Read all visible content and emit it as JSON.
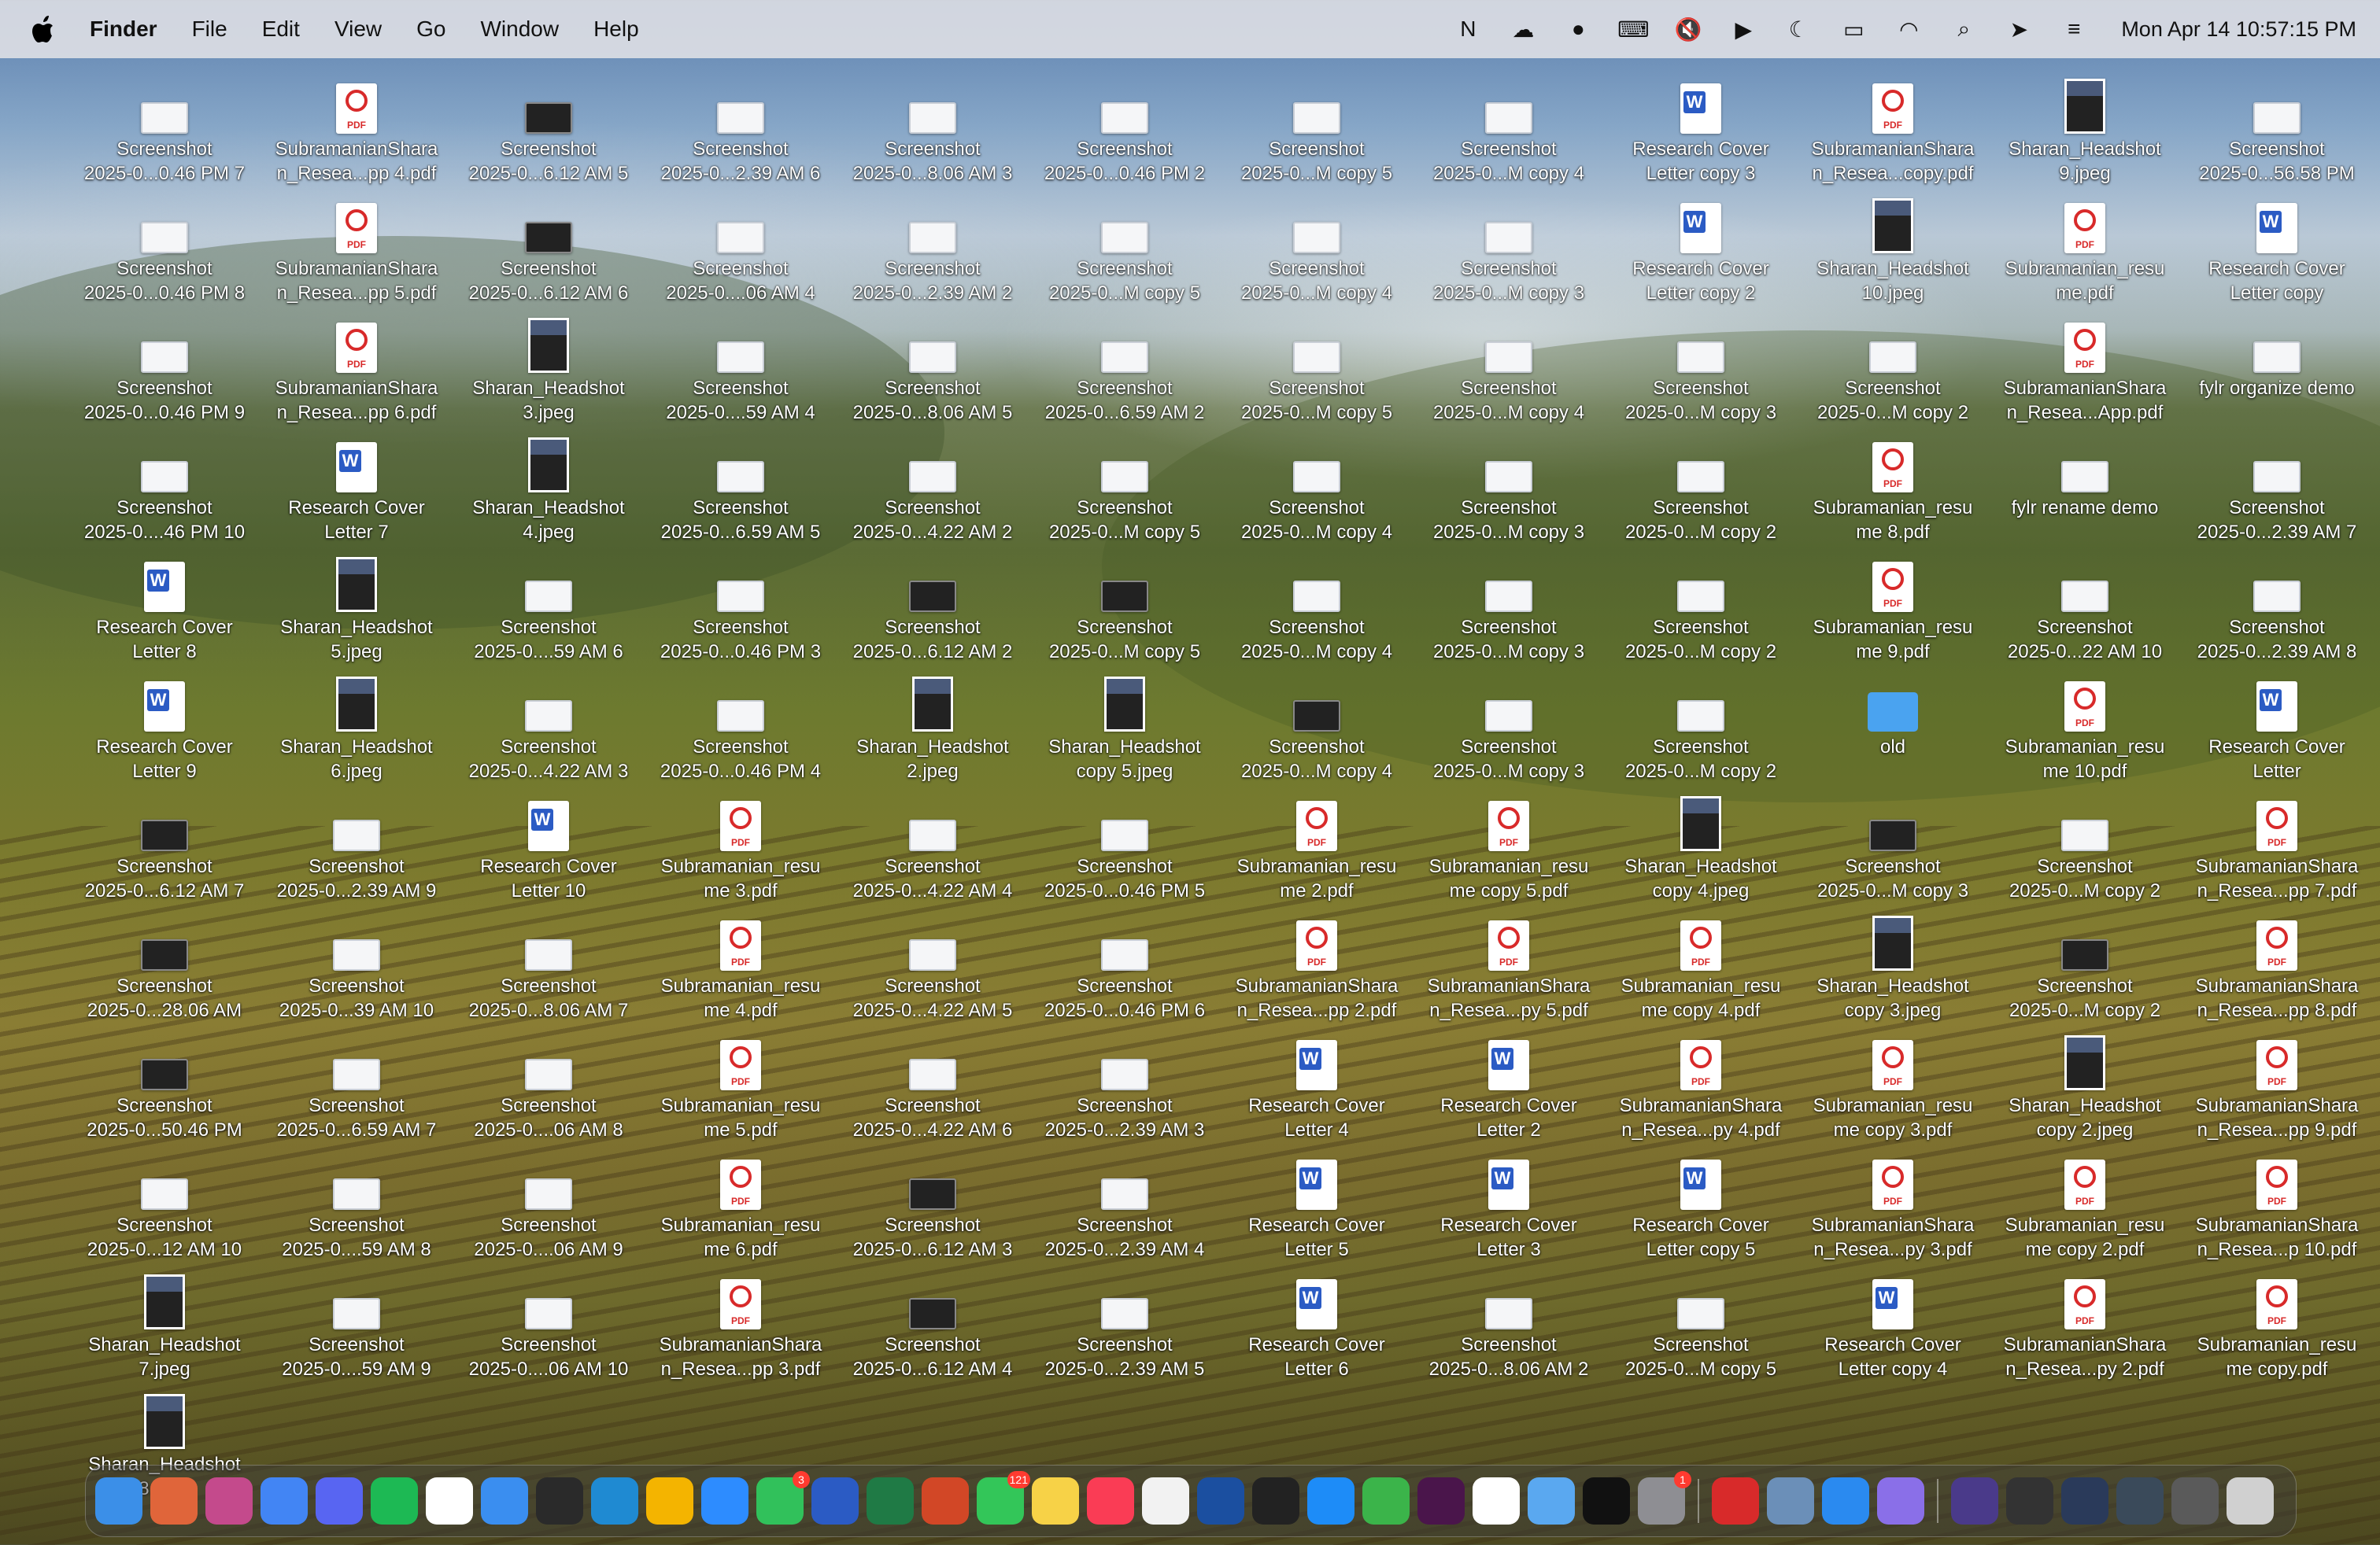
{
  "menubar": {
    "app_name": "Finder",
    "menus": [
      "File",
      "Edit",
      "View",
      "Go",
      "Window",
      "Help"
    ],
    "status_icons": [
      "notion-icon",
      "creative-cloud-icon",
      "stop-icon",
      "keyboard-icon",
      "mute-icon",
      "play-icon",
      "moon-icon",
      "battery-icon",
      "wifi-icon",
      "search-icon",
      "location-icon",
      "control-center-icon"
    ],
    "clock": "Mon Apr 14  10:57:15 PM"
  },
  "desktop_icons": [
    {
      "kind": "shot",
      "name": "Screenshot 2025-0...0.46 PM 7"
    },
    {
      "kind": "pdf",
      "name": "SubramanianShara n_Resea...pp 4.pdf"
    },
    {
      "kind": "shotd",
      "name": "Screenshot 2025-0...6.12 AM 5"
    },
    {
      "kind": "shot",
      "name": "Screenshot 2025-0...2.39 AM 6"
    },
    {
      "kind": "shot",
      "name": "Screenshot 2025-0...8.06 AM 3"
    },
    {
      "kind": "shot",
      "name": "Screenshot 2025-0...0.46 PM 2"
    },
    {
      "kind": "shot",
      "name": "Screenshot 2025-0...M copy 5"
    },
    {
      "kind": "shot",
      "name": "Screenshot 2025-0...M copy 4"
    },
    {
      "kind": "doc",
      "name": "Research Cover Letter copy 3"
    },
    {
      "kind": "pdf",
      "name": "SubramanianShara n_Resea...copy.pdf"
    },
    {
      "kind": "jpg",
      "name": "Sharan_Headshot 9.jpeg"
    },
    {
      "kind": "shot",
      "name": "Screenshot 2025-0...56.58 PM"
    },
    {
      "kind": "shot",
      "name": "Screenshot 2025-0...0.46 PM 8"
    },
    {
      "kind": "pdf",
      "name": "SubramanianShara n_Resea...pp 5.pdf"
    },
    {
      "kind": "shotd",
      "name": "Screenshot 2025-0...6.12 AM 6"
    },
    {
      "kind": "shot",
      "name": "Screenshot 2025-0....06 AM 4"
    },
    {
      "kind": "shot",
      "name": "Screenshot 2025-0...2.39 AM 2"
    },
    {
      "kind": "shot",
      "name": "Screenshot 2025-0...M copy 5"
    },
    {
      "kind": "shot",
      "name": "Screenshot 2025-0...M copy 4"
    },
    {
      "kind": "shot",
      "name": "Screenshot 2025-0...M copy 3"
    },
    {
      "kind": "doc",
      "name": "Research Cover Letter copy 2"
    },
    {
      "kind": "jpg",
      "name": "Sharan_Headshot 10.jpeg"
    },
    {
      "kind": "pdf",
      "name": "Subramanian_resu me.pdf"
    },
    {
      "kind": "doc",
      "name": "Research Cover Letter copy"
    },
    {
      "kind": "shot",
      "name": "Screenshot 2025-0...0.46 PM 9"
    },
    {
      "kind": "pdf",
      "name": "SubramanianShara n_Resea...pp 6.pdf"
    },
    {
      "kind": "jpg",
      "name": "Sharan_Headshot 3.jpeg"
    },
    {
      "kind": "shot",
      "name": "Screenshot 2025-0....59 AM 4"
    },
    {
      "kind": "shot",
      "name": "Screenshot 2025-0...8.06 AM 5"
    },
    {
      "kind": "shot",
      "name": "Screenshot 2025-0...6.59 AM 2"
    },
    {
      "kind": "shot",
      "name": "Screenshot 2025-0...M copy 5"
    },
    {
      "kind": "shot",
      "name": "Screenshot 2025-0...M copy 4"
    },
    {
      "kind": "shot",
      "name": "Screenshot 2025-0...M copy 3"
    },
    {
      "kind": "shot",
      "name": "Screenshot 2025-0...M copy 2"
    },
    {
      "kind": "pdf",
      "name": "SubramanianShara n_Resea...App.pdf"
    },
    {
      "kind": "shot",
      "name": "fylr organize demo"
    },
    {
      "kind": "shot",
      "name": "Screenshot 2025-0....46 PM 10"
    },
    {
      "kind": "doc",
      "name": "Research Cover Letter 7"
    },
    {
      "kind": "jpg",
      "name": "Sharan_Headshot 4.jpeg"
    },
    {
      "kind": "shot",
      "name": "Screenshot 2025-0...6.59 AM 5"
    },
    {
      "kind": "shot",
      "name": "Screenshot 2025-0...4.22 AM 2"
    },
    {
      "kind": "shot",
      "name": "Screenshot 2025-0...M copy 5"
    },
    {
      "kind": "shot",
      "name": "Screenshot 2025-0...M copy 4"
    },
    {
      "kind": "shot",
      "name": "Screenshot 2025-0...M copy 3"
    },
    {
      "kind": "shot",
      "name": "Screenshot 2025-0...M copy 2"
    },
    {
      "kind": "pdf",
      "name": "Subramanian_resu me 8.pdf"
    },
    {
      "kind": "shot",
      "name": "fylr rename demo"
    },
    {
      "kind": "shot",
      "name": "Screenshot 2025-0...2.39 AM 7"
    },
    {
      "kind": "doc",
      "name": "Research Cover Letter 8"
    },
    {
      "kind": "jpg",
      "name": "Sharan_Headshot 5.jpeg"
    },
    {
      "kind": "shot",
      "name": "Screenshot 2025-0....59 AM 6"
    },
    {
      "kind": "shot",
      "name": "Screenshot 2025-0...0.46 PM 3"
    },
    {
      "kind": "shotd",
      "name": "Screenshot 2025-0...6.12 AM 2"
    },
    {
      "kind": "shotd",
      "name": "Screenshot 2025-0...M copy 5"
    },
    {
      "kind": "shot",
      "name": "Screenshot 2025-0...M copy 4"
    },
    {
      "kind": "shot",
      "name": "Screenshot 2025-0...M copy 3"
    },
    {
      "kind": "shot",
      "name": "Screenshot 2025-0...M copy 2"
    },
    {
      "kind": "pdf",
      "name": "Subramanian_resu me 9.pdf"
    },
    {
      "kind": "shot",
      "name": "Screenshot 2025-0...22 AM 10"
    },
    {
      "kind": "shot",
      "name": "Screenshot 2025-0...2.39 AM 8"
    },
    {
      "kind": "doc",
      "name": "Research Cover Letter 9"
    },
    {
      "kind": "jpg",
      "name": "Sharan_Headshot 6.jpeg"
    },
    {
      "kind": "shot",
      "name": "Screenshot 2025-0...4.22 AM 3"
    },
    {
      "kind": "shot",
      "name": "Screenshot 2025-0...0.46 PM 4"
    },
    {
      "kind": "jpg",
      "name": "Sharan_Headshot 2.jpeg"
    },
    {
      "kind": "jpg",
      "name": "Sharan_Headshot copy 5.jpeg"
    },
    {
      "kind": "shotd",
      "name": "Screenshot 2025-0...M copy 4"
    },
    {
      "kind": "shot",
      "name": "Screenshot 2025-0...M copy 3"
    },
    {
      "kind": "shot",
      "name": "Screenshot 2025-0...M copy 2"
    },
    {
      "kind": "folder",
      "name": "old"
    },
    {
      "kind": "pdf",
      "name": "Subramanian_resu me 10.pdf"
    },
    {
      "kind": "doc",
      "name": "Research Cover Letter"
    },
    {
      "kind": "shotd",
      "name": "Screenshot 2025-0...6.12 AM 7"
    },
    {
      "kind": "shot",
      "name": "Screenshot 2025-0...2.39 AM 9"
    },
    {
      "kind": "doc",
      "name": "Research Cover Letter 10"
    },
    {
      "kind": "pdf",
      "name": "Subramanian_resu me 3.pdf"
    },
    {
      "kind": "shot",
      "name": "Screenshot 2025-0...4.22 AM 4"
    },
    {
      "kind": "shot",
      "name": "Screenshot 2025-0...0.46 PM 5"
    },
    {
      "kind": "pdf",
      "name": "Subramanian_resu me 2.pdf"
    },
    {
      "kind": "pdf",
      "name": "Subramanian_resu me copy 5.pdf"
    },
    {
      "kind": "jpg",
      "name": "Sharan_Headshot copy 4.jpeg"
    },
    {
      "kind": "shotd",
      "name": "Screenshot 2025-0...M copy 3"
    },
    {
      "kind": "shot",
      "name": "Screenshot 2025-0...M copy 2"
    },
    {
      "kind": "pdf",
      "name": "SubramanianShara n_Resea...pp 7.pdf"
    },
    {
      "kind": "shotd",
      "name": "Screenshot 2025-0...28.06 AM"
    },
    {
      "kind": "shot",
      "name": "Screenshot 2025-0...39 AM 10"
    },
    {
      "kind": "shot",
      "name": "Screenshot 2025-0...8.06 AM 7"
    },
    {
      "kind": "pdf",
      "name": "Subramanian_resu me 4.pdf"
    },
    {
      "kind": "shot",
      "name": "Screenshot 2025-0...4.22 AM 5"
    },
    {
      "kind": "shot",
      "name": "Screenshot 2025-0...0.46 PM 6"
    },
    {
      "kind": "pdf",
      "name": "SubramanianShara n_Resea...pp 2.pdf"
    },
    {
      "kind": "pdf",
      "name": "SubramanianShara n_Resea...py 5.pdf"
    },
    {
      "kind": "pdf",
      "name": "Subramanian_resu me copy 4.pdf"
    },
    {
      "kind": "jpg",
      "name": "Sharan_Headshot copy 3.jpeg"
    },
    {
      "kind": "shotd",
      "name": "Screenshot 2025-0...M copy 2"
    },
    {
      "kind": "pdf",
      "name": "SubramanianShara n_Resea...pp 8.pdf"
    },
    {
      "kind": "shotd",
      "name": "Screenshot 2025-0...50.46 PM"
    },
    {
      "kind": "shot",
      "name": "Screenshot 2025-0...6.59 AM 7"
    },
    {
      "kind": "shot",
      "name": "Screenshot 2025-0....06 AM 8"
    },
    {
      "kind": "pdf",
      "name": "Subramanian_resu me 5.pdf"
    },
    {
      "kind": "shot",
      "name": "Screenshot 2025-0...4.22 AM 6"
    },
    {
      "kind": "shot",
      "name": "Screenshot 2025-0...2.39 AM 3"
    },
    {
      "kind": "doc",
      "name": "Research Cover Letter 4"
    },
    {
      "kind": "doc",
      "name": "Research Cover Letter 2"
    },
    {
      "kind": "pdf",
      "name": "SubramanianShara n_Resea...py 4.pdf"
    },
    {
      "kind": "pdf",
      "name": "Subramanian_resu me copy 3.pdf"
    },
    {
      "kind": "jpg",
      "name": "Sharan_Headshot copy 2.jpeg"
    },
    {
      "kind": "pdf",
      "name": "SubramanianShara n_Resea...pp 9.pdf"
    },
    {
      "kind": "shot",
      "name": "Screenshot 2025-0...12 AM 10"
    },
    {
      "kind": "shot",
      "name": "Screenshot 2025-0....59 AM 8"
    },
    {
      "kind": "shot",
      "name": "Screenshot 2025-0....06 AM 9"
    },
    {
      "kind": "pdf",
      "name": "Subramanian_resu me 6.pdf"
    },
    {
      "kind": "shotd",
      "name": "Screenshot 2025-0...6.12 AM 3"
    },
    {
      "kind": "shot",
      "name": "Screenshot 2025-0...2.39 AM 4"
    },
    {
      "kind": "doc",
      "name": "Research Cover Letter 5"
    },
    {
      "kind": "doc",
      "name": "Research Cover Letter 3"
    },
    {
      "kind": "doc",
      "name": "Research Cover Letter copy 5"
    },
    {
      "kind": "pdf",
      "name": "SubramanianShara n_Resea...py 3.pdf"
    },
    {
      "kind": "pdf",
      "name": "Subramanian_resu me copy 2.pdf"
    },
    {
      "kind": "pdf",
      "name": "SubramanianShara n_Resea...p 10.pdf"
    },
    {
      "kind": "jpg",
      "name": "Sharan_Headshot 7.jpeg"
    },
    {
      "kind": "shot",
      "name": "Screenshot 2025-0....59 AM 9"
    },
    {
      "kind": "shot",
      "name": "Screenshot 2025-0....06 AM 10"
    },
    {
      "kind": "pdf",
      "name": "SubramanianShara n_Resea...pp 3.pdf"
    },
    {
      "kind": "shotd",
      "name": "Screenshot 2025-0...6.12 AM 4"
    },
    {
      "kind": "shot",
      "name": "Screenshot 2025-0...2.39 AM 5"
    },
    {
      "kind": "doc",
      "name": "Research Cover Letter 6"
    },
    {
      "kind": "shot",
      "name": "Screenshot 2025-0...8.06 AM 2"
    },
    {
      "kind": "shot",
      "name": "Screenshot 2025-0...M copy 5"
    },
    {
      "kind": "doc",
      "name": "Research Cover Letter copy 4"
    },
    {
      "kind": "pdf",
      "name": "SubramanianShara n_Resea...py 2.pdf"
    },
    {
      "kind": "pdf",
      "name": "Subramanian_resu me copy.pdf"
    },
    {
      "kind": "jpg",
      "name": "Sharan_Headshot 8.jpeg"
    }
  ],
  "dock": {
    "apps": [
      {
        "name": "finder-icon",
        "color": "#3b8fe8"
      },
      {
        "name": "launchpad-icon",
        "color": "#e0653a"
      },
      {
        "name": "photo-app-icon",
        "color": "#c44a8c"
      },
      {
        "name": "chrome-icon",
        "color": "#4285f4"
      },
      {
        "name": "discord-icon",
        "color": "#5865f2"
      },
      {
        "name": "spotify-icon",
        "color": "#1db954"
      },
      {
        "name": "notion-icon",
        "color": "#ffffff"
      },
      {
        "name": "mail-icon",
        "color": "#3a8ef0"
      },
      {
        "name": "cube-app-icon",
        "color": "#2a2a2a"
      },
      {
        "name": "vscode-icon",
        "color": "#1f8ad2"
      },
      {
        "name": "photos-icon",
        "color": "#f4b400"
      },
      {
        "name": "zoom-icon",
        "color": "#2d8cff"
      },
      {
        "name": "facetime-icon",
        "color": "#31c15b",
        "badge": "3"
      },
      {
        "name": "word-icon",
        "color": "#2b5bc4"
      },
      {
        "name": "excel-icon",
        "color": "#1f7a45"
      },
      {
        "name": "powerpoint-icon",
        "color": "#d24726"
      },
      {
        "name": "messages-icon",
        "color": "#33c659",
        "badge": "121"
      },
      {
        "name": "notes-icon",
        "color": "#f7d247"
      },
      {
        "name": "music-icon",
        "color": "#fa3c55"
      },
      {
        "name": "freeform-icon",
        "color": "#f2f2f2"
      },
      {
        "name": "reader-icon",
        "color": "#1b4fa0"
      },
      {
        "name": "chatgpt-icon",
        "color": "#222222"
      },
      {
        "name": "app-store-icon",
        "color": "#1d8cf8"
      },
      {
        "name": "circle-app-icon",
        "color": "#3bb44a"
      },
      {
        "name": "slack-icon",
        "color": "#4a154b"
      },
      {
        "name": "calendar-icon",
        "color": "#ffffff"
      },
      {
        "name": "affinity-icon",
        "color": "#5aa8f0"
      },
      {
        "name": "openai-icon",
        "color": "#111111"
      },
      {
        "name": "system-settings-icon",
        "color": "#8e8e93",
        "badge": "1"
      },
      {
        "name": "acrobat-icon",
        "color": "#d82a2a"
      },
      {
        "name": "preview-icon",
        "color": "#6b8fb8"
      },
      {
        "name": "safari-icon",
        "color": "#2a8af0"
      },
      {
        "name": "arc-icon",
        "color": "#8a6fe8"
      },
      {
        "name": "window-thumb-1-icon",
        "color": "#4a3a8a"
      },
      {
        "name": "window-thumb-2-icon",
        "color": "#333333"
      },
      {
        "name": "window-thumb-3-icon",
        "color": "#2a3a5a"
      },
      {
        "name": "window-thumb-4-icon",
        "color": "#3a4a5a"
      },
      {
        "name": "window-thumb-5-icon",
        "color": "#5a5a5a"
      },
      {
        "name": "trash-icon",
        "color": "#d0d0d0"
      }
    ]
  }
}
